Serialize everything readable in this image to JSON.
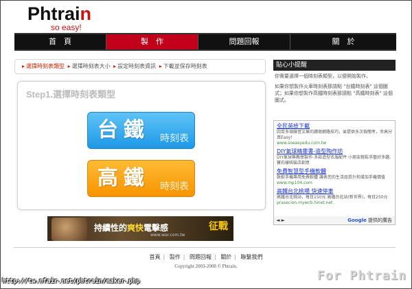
{
  "logo": {
    "main": "Phtrai",
    "main_last": "n",
    "sub": "so easy!"
  },
  "nav": {
    "items": [
      {
        "label": "首　頁",
        "active": false
      },
      {
        "label": "製　作",
        "active": true
      },
      {
        "label": "問題回報",
        "active": false
      },
      {
        "label": "關　於",
        "active": false
      }
    ]
  },
  "breadcrumb": {
    "steps": [
      "選擇時刻表類型",
      "選擇時刻表大小",
      "設定時刻表資訊",
      "下載並保存時刻表"
    ],
    "arrow": "▸"
  },
  "panel": {
    "title": "Step1.選擇時刻表類型",
    "btn_tra_main": "台鐵",
    "btn_tra_sub": "時刻表",
    "btn_hsr_main": "高鐵",
    "btn_hsr_sub": "時刻表"
  },
  "banner": {
    "slogan_a": "持續性的",
    "slogan_b": "爽快",
    "slogan_c": "電擊感",
    "url": "www.war.com.tw",
    "game": "征戰"
  },
  "tips": {
    "title": "貼心小提醒",
    "p1": "你需要選擇一個時刻表類型，以便開始製作。",
    "p2": "如果你想製作火車時刻表那請點 \"台鐵時刻表\" 這個圖式；如果你想製作高鐵時刻表那請點 \"高鐵時刻表\" 這個圖式。"
  },
  "ads": {
    "items": [
      {
        "title": "全民英檢下載",
        "desc": "四百多項錄音文章的讀寫網路技巧，並提供多次檢閱考，幸高分真Easy!",
        "url": "www.soeasyedu.com.tw"
      },
      {
        "title": "DIY氣球精靈書-造型陶作坊",
        "desc": "DIY氣球無教學製作-多款造型衣服配件 小朋友輕鬆手藝好多趣,寶石樣唔裝店創意",
        "url": ""
      },
      {
        "title": "免費智慧型手機軟體",
        "desc": "致軟手機專用免費軟體 讓表您的生活品質升和增加手機價值",
        "url": "www.mp104.com"
      },
      {
        "title": "高鐵台北桃場 快速停車",
        "desc": "高鐵台北桃站，每日150元 高鐵台北站(新世界)，每日250元",
        "url": "prasecion.mywcb.hinet.net"
      }
    ],
    "nav": "◄ ►",
    "provider_a": "Google",
    "provider_b": " 提供的廣告"
  },
  "footer": {
    "links": [
      "首頁",
      "製作",
      "問題回報",
      "關於",
      "聯繫我們"
    ],
    "copyright": "Copyright 2003-2008 © Phtrain."
  },
  "overlay": {
    "url": "http://tw.nfair.net/phtrain/maker.php",
    "watermark": "For Phtrain"
  }
}
